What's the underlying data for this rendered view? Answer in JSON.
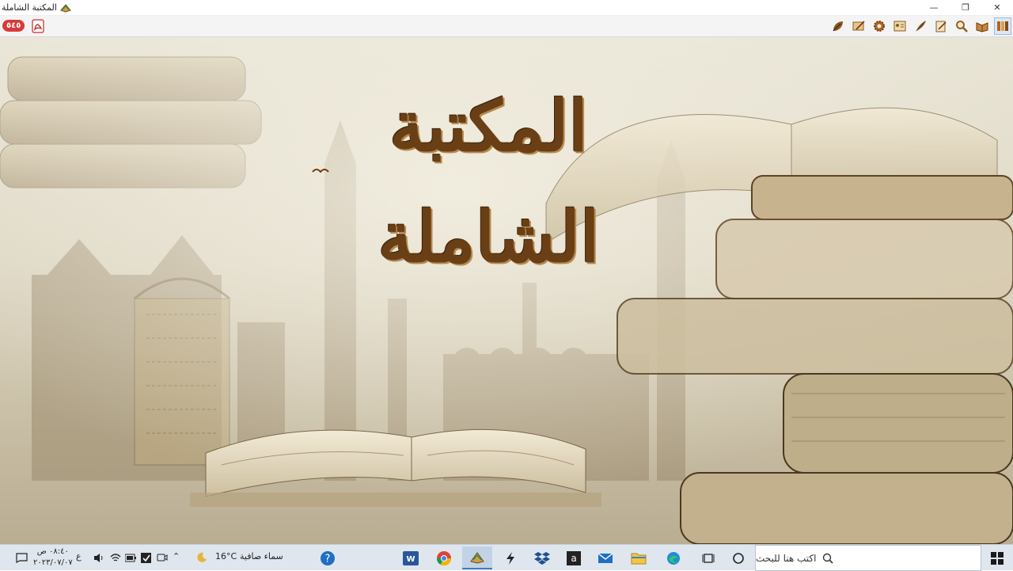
{
  "window": {
    "title": "المكتبة الشاملة",
    "controls": {
      "minimize": "—",
      "maximize": "❐",
      "close": "✕"
    }
  },
  "toolbar": {
    "badge": "٥٤٥",
    "tools": [
      "leaf-icon",
      "edit-note-icon",
      "gear-icon",
      "id-card-icon",
      "quill-icon",
      "open-book-icon",
      "search-icon",
      "bookmark-icon",
      "library-icon"
    ]
  },
  "splash": {
    "calligraphy": "المكتبة الشاملة"
  },
  "taskbar": {
    "search_placeholder": "اكتب هنا للبحث",
    "weather_text": "سماء صافية",
    "temperature": "16°C",
    "language": "ع",
    "time": "٠٨:٤٠ ص",
    "date": "٢٠٢٣/٠٧/٠٧"
  }
}
